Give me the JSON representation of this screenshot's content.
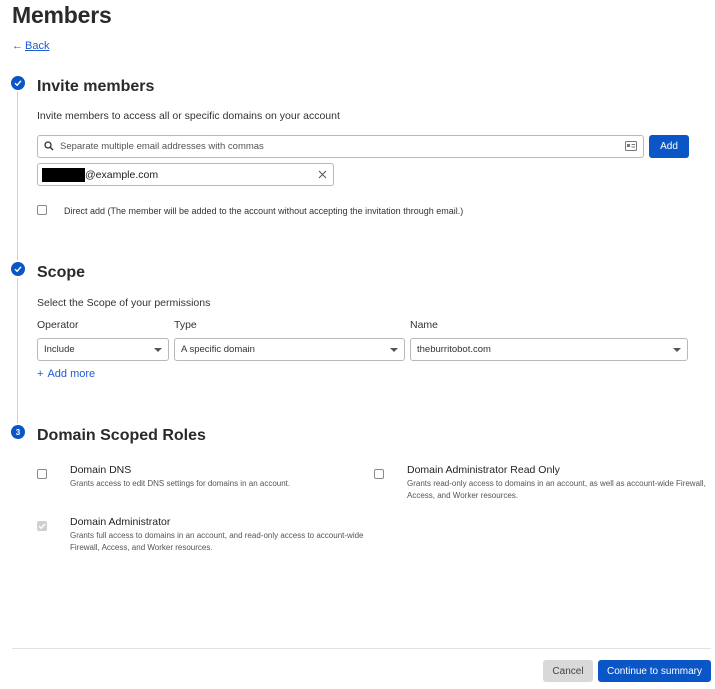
{
  "page": {
    "title": "Members",
    "back_label": "Back"
  },
  "invite": {
    "step_title": "Invite members",
    "description": "Invite members to access all or specific domains on your account",
    "email_placeholder": "Separate multiple email addresses with commas",
    "add_label": "Add",
    "chip_email": "@example.com",
    "direct_add_label": "Direct add (The member will be added to the account without accepting the invitation through email.)",
    "direct_add_checked": false
  },
  "scope": {
    "step_title": "Scope",
    "description": "Select the Scope of your permissions",
    "operator_label": "Operator",
    "type_label": "Type",
    "name_label": "Name",
    "operator_value": "Include",
    "type_value": "A specific domain",
    "name_value": "theburritobot.com",
    "add_more_label": "Add more"
  },
  "roles": {
    "step_number": "3",
    "step_title": "Domain Scoped Roles",
    "items": [
      {
        "title": "Domain DNS",
        "desc": "Grants access to edit DNS settings for domains in an account.",
        "checked": false
      },
      {
        "title": "Domain Administrator Read Only",
        "desc": "Grants read-only access to domains in an account, as well as account-wide Firewall, Access, and Worker resources.",
        "checked": false
      },
      {
        "title": "Domain Administrator",
        "desc": "Grants full access to domains in an account, and read-only access to account-wide Firewall, Access, and Worker resources.",
        "checked": true
      }
    ]
  },
  "footer": {
    "cancel_label": "Cancel",
    "continue_label": "Continue to summary"
  },
  "colors": {
    "accent": "#0b56c6",
    "link": "#1f5bd1",
    "disabled": "#d9d9d9"
  }
}
